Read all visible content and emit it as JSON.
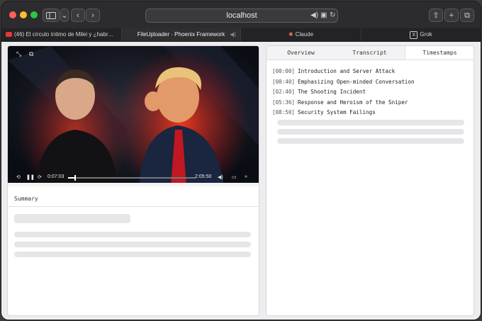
{
  "browser": {
    "address": "localhost",
    "tabs": [
      {
        "label": "(46) El círculo íntimo de Milei y ¿habr…",
        "favicon_color": "#e53935",
        "active": false
      },
      {
        "label": "FileUploader · Phoenix Framework",
        "favicon_color": "",
        "active": true
      },
      {
        "label": "Claude",
        "favicon_color": "#d97757",
        "active": false
      },
      {
        "label": "Grok",
        "favicon_color": "#ffffff",
        "active": false
      }
    ]
  },
  "player": {
    "current_time": "0:07:03",
    "duration": "2:05:50",
    "progress_fraction": 0.056
  },
  "summary": {
    "heading": "Summary"
  },
  "panel": {
    "tabs": [
      {
        "label": "Overview",
        "active": false
      },
      {
        "label": "Transcript",
        "active": false
      },
      {
        "label": "Timestamps",
        "active": true
      }
    ],
    "timestamps": [
      {
        "time": "[00:00]",
        "title": "Introduction and Server Attack"
      },
      {
        "time": "[00:40]",
        "title": "Emphasizing Open-minded Conversation"
      },
      {
        "time": "[02:40]",
        "title": "The Shooting Incident"
      },
      {
        "time": "[05:36]",
        "title": "Response and Heroism of the Sniper"
      },
      {
        "time": "[08:50]",
        "title": "Security System Failings"
      }
    ]
  },
  "colors": {
    "accent_red": "#d22a1e",
    "page_bg": "#ededef"
  }
}
